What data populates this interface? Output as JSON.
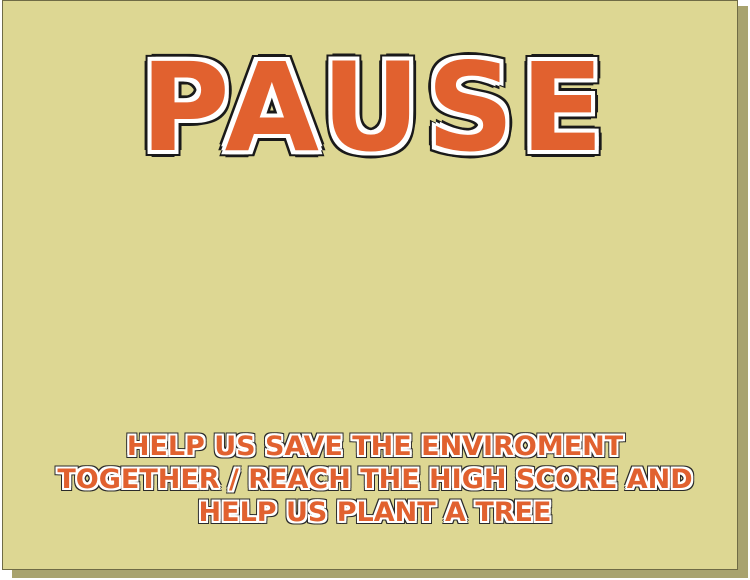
{
  "screen": {
    "title": "PAUSE",
    "message_lines": [
      "HELP US SAVE THE ENVIROMENT",
      "TOGETHER / REACH THE HIGH SCORE AND",
      "HELP US PLANT A TREE"
    ]
  },
  "colors": {
    "panel": "#ddd793",
    "panel_shadow": "#a8a36e",
    "title_fill": "#e1612f",
    "outline_inner": "#ffffff",
    "outline_outer": "#1a1a1a"
  }
}
